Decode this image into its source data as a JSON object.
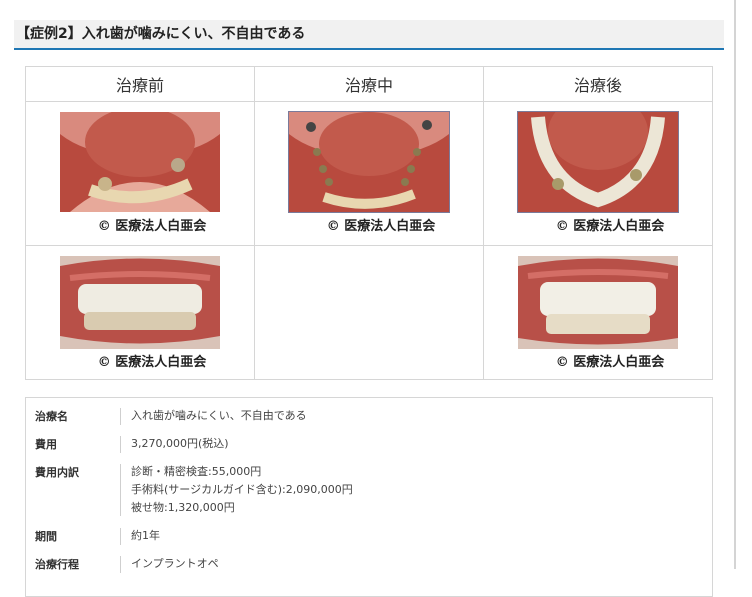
{
  "heading": "【症例2】入れ歯が噛みにくい、不自由である",
  "table": {
    "headers": [
      "治療前",
      "治療中",
      "治療後"
    ],
    "credit": "© 医療法人白亜会"
  },
  "info": {
    "rows": [
      {
        "label": "治療名",
        "lines": [
          "入れ歯が噛みにくい、不自由である"
        ]
      },
      {
        "label": "費用",
        "lines": [
          "3,270,000円(税込)"
        ]
      },
      {
        "label": "費用内訳",
        "lines": [
          "診断・精密検査:55,000円",
          "手術料(サージカルガイド含む):2,090,000円",
          "被せ物:1,320,000円"
        ]
      },
      {
        "label": "期間",
        "lines": [
          "約1年"
        ]
      },
      {
        "label": "治療行程",
        "lines": [
          "インプラントオペ"
        ]
      }
    ]
  }
}
